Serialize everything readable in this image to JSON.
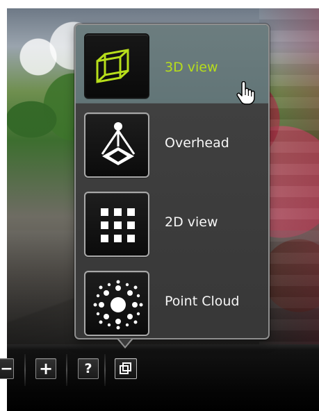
{
  "app": {
    "menu": {
      "items": [
        {
          "label": "3D view",
          "icon": "3d-view-icon",
          "active": true
        },
        {
          "label": "Overhead",
          "icon": "overhead-icon",
          "active": false
        },
        {
          "label": "2D view",
          "icon": "2d-view-icon",
          "active": false
        },
        {
          "label": "Point Cloud",
          "icon": "point-cloud-icon",
          "active": false
        }
      ]
    },
    "toolbar": {
      "minus_label": "−",
      "plus_label": "+",
      "help_label": "?",
      "view_icon": "view-mode-icon"
    },
    "colors": {
      "accent": "#b7de1b",
      "panel": "#3b3b3b",
      "active_row": "#6c7d7f",
      "toolbar": "#050505"
    }
  }
}
